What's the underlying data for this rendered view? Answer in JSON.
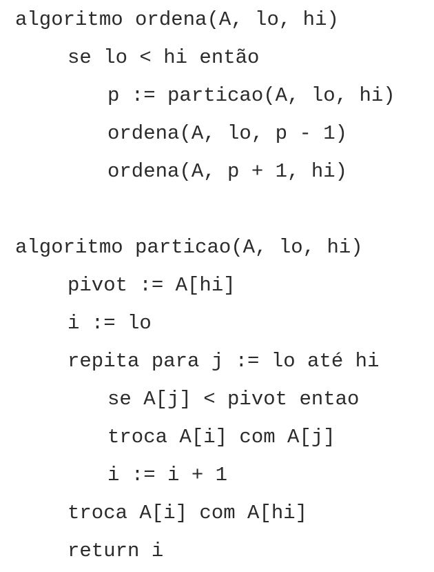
{
  "code": {
    "lines": [
      "algoritmo ordena(A, lo, hi)",
      "se lo < hi então",
      "p := particao(A, lo, hi)",
      "ordena(A, lo, p - 1)",
      "ordena(A, p + 1, hi)",
      "algoritmo particao(A, lo, hi)",
      "pivot := A[hi]",
      "i := lo",
      "repita para j := lo até hi",
      "se A[j] < pivot entao",
      "troca A[i] com A[j]",
      "i := i + 1",
      "troca A[i] com A[hi]",
      "return i"
    ]
  }
}
